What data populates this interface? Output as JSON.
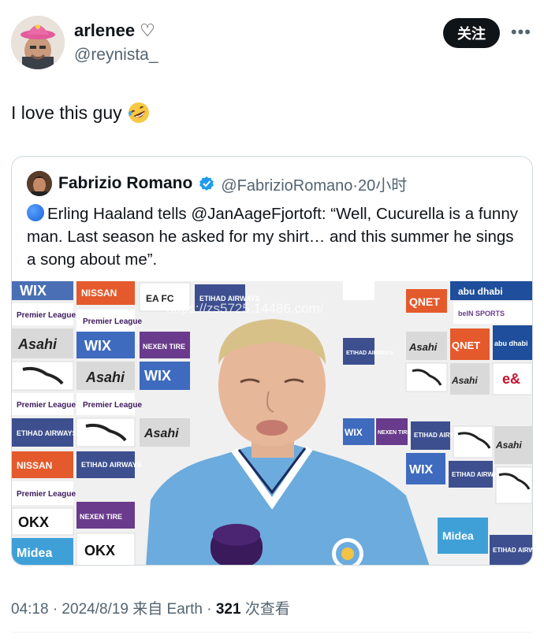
{
  "author": {
    "display_name": "arlenee",
    "heart": "♡",
    "handle": "@reynista_"
  },
  "follow_label": "关注",
  "more_label": "•••",
  "tweet_text": "I love this guy",
  "emoji": "rolling-on-floor-laughing-emoji",
  "quoted": {
    "display_name": "Fabrizio Romano",
    "handle_time": "@FabrizioRomano·20小时",
    "text": "Erling Haaland tells @JanAageFjortoft: “Well, Cucurella is a funny man. Last season he asked for my shirt… and this summer he sings a song about me”.",
    "photo": {
      "watermark": "https://zs5725.14486.com/",
      "board_texts": [
        "WIX",
        "NISSAN",
        "Premier League",
        "ETIHAD AIRWAYS",
        "Asahi",
        "NEXEN TIRE",
        "QNET",
        "abu dhabi",
        "beIN SPORTS",
        "OKX",
        "Midea",
        "EA FC"
      ]
    }
  },
  "footer": {
    "time_date": "04:18 · 2024/8/19 来自 Earth · ",
    "views_count": "321",
    "views_label": " 次查看"
  },
  "colors": {
    "text_primary": "#0f1419",
    "text_secondary": "#536471",
    "border": "#cfd9de",
    "verified_blue": "#1d9bf0",
    "kit_sky_blue": "#6cabdd"
  }
}
